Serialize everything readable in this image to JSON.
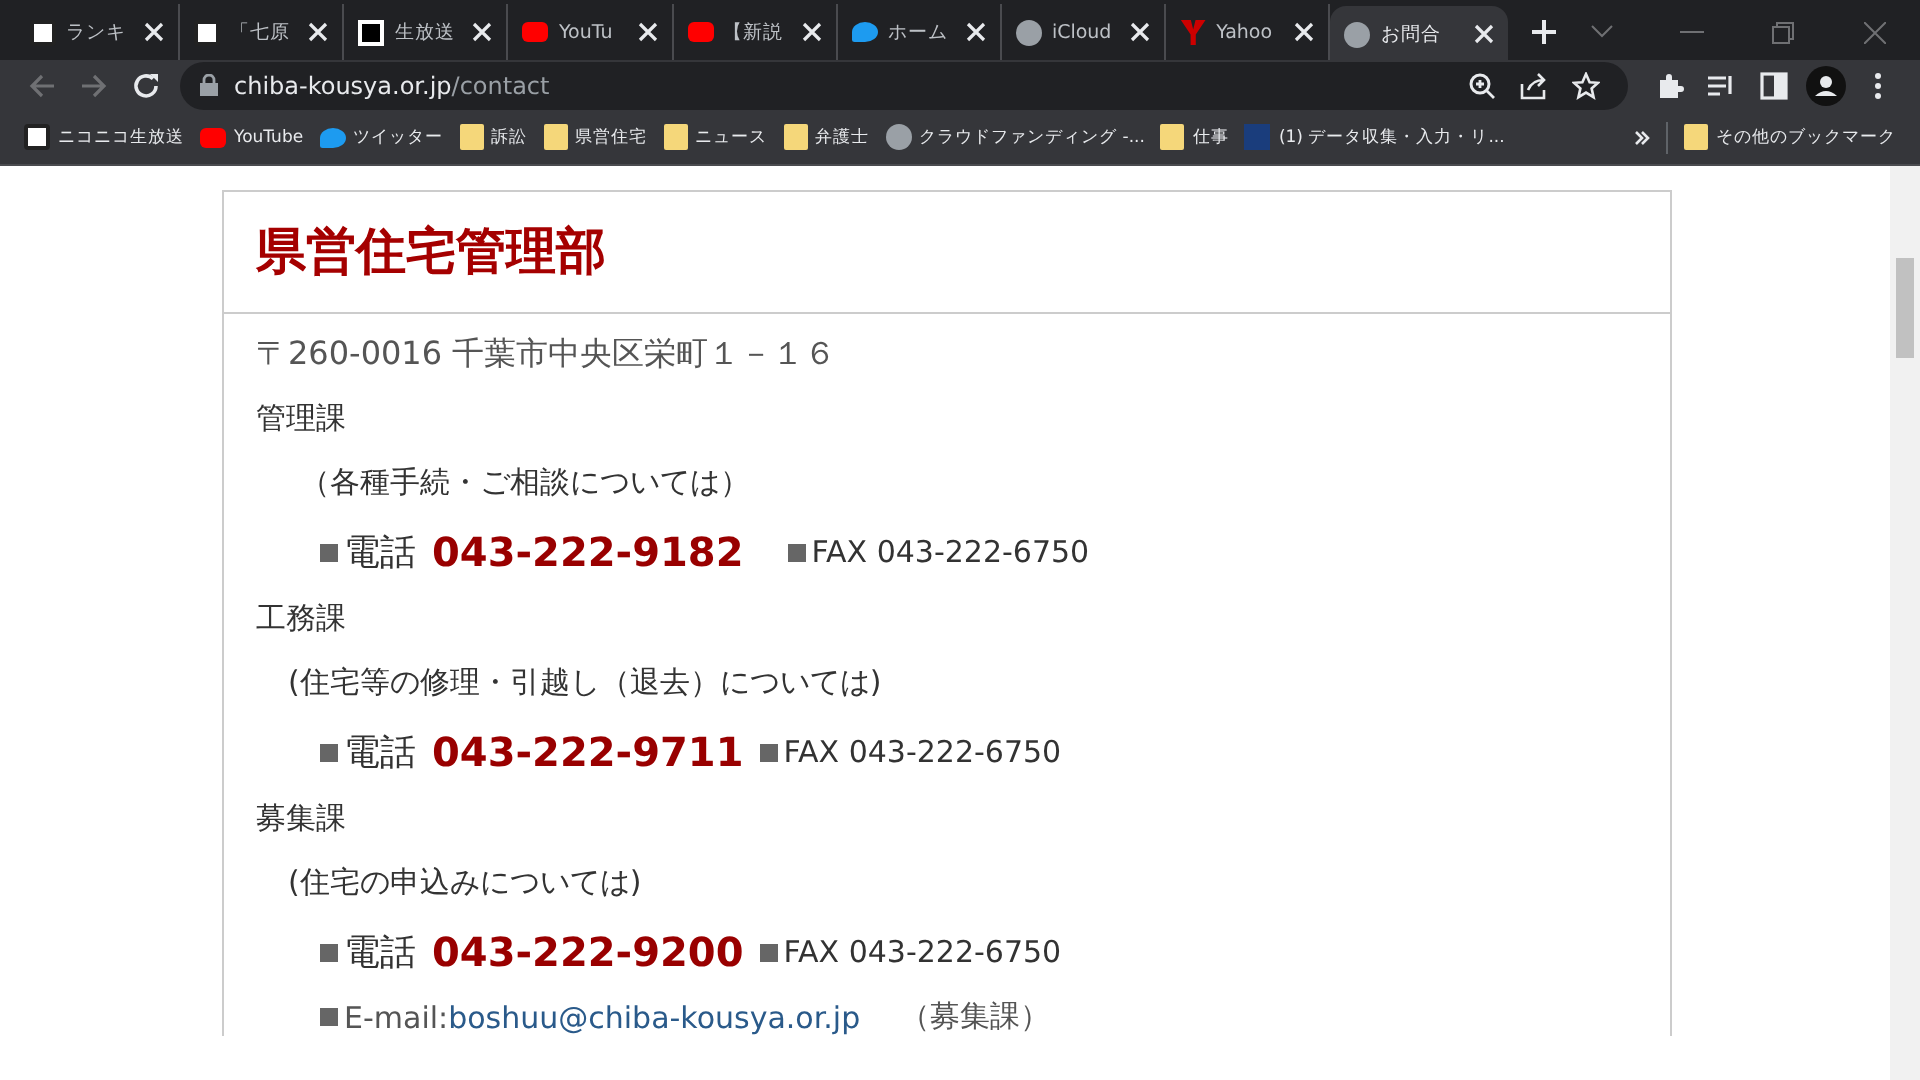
{
  "tabs": [
    {
      "title": "ランキ",
      "selected": false
    },
    {
      "title": "「七原",
      "selected": false
    },
    {
      "title": "生放送",
      "selected": false
    },
    {
      "title": "YouTu",
      "selected": false
    },
    {
      "title": "【新説",
      "selected": false
    },
    {
      "title": "ホーム",
      "selected": false
    },
    {
      "title": "iCloud",
      "selected": false
    },
    {
      "title": "Yahoo",
      "selected": false
    },
    {
      "title": "お問合",
      "selected": true
    }
  ],
  "address": {
    "domain": "chiba-kousya.or.jp",
    "path": "/contact"
  },
  "bookmarks": [
    {
      "label": "ニコニコ生放送"
    },
    {
      "label": "YouTube"
    },
    {
      "label": "ツイッター"
    },
    {
      "label": "訴訟"
    },
    {
      "label": "県営住宅"
    },
    {
      "label": "ニュース"
    },
    {
      "label": "弁護士"
    },
    {
      "label": "クラウドファンディング -..."
    },
    {
      "label": "仕事"
    },
    {
      "label": "(1) データ収集・入力・リ..."
    }
  ],
  "other_bookmarks": "その他のブックマーク",
  "card": {
    "title": "県営住宅管理部",
    "address": "〒260-0016 千葉市中央区栄町１－１６",
    "sections": [
      {
        "name": "管理課",
        "note": "（各種手続・ご相談については）",
        "phone_label": "電話",
        "phone": "043-222-9182",
        "fax": "FAX 043-222-6750"
      },
      {
        "name": "工務課",
        "note": "(住宅等の修理・引越し（退去）については)",
        "phone_label": "電話",
        "phone": "043-222-9711",
        "fax": "FAX 043-222-6750"
      },
      {
        "name": "募集課",
        "note": "(住宅の申込みについては)",
        "phone_label": "電話",
        "phone": "043-222-9200",
        "fax": "FAX 043-222-6750",
        "email_label": "E-mail:",
        "email": "boshuu@chiba-kousya.or.jp",
        "email_note": "（募集課）"
      }
    ]
  }
}
